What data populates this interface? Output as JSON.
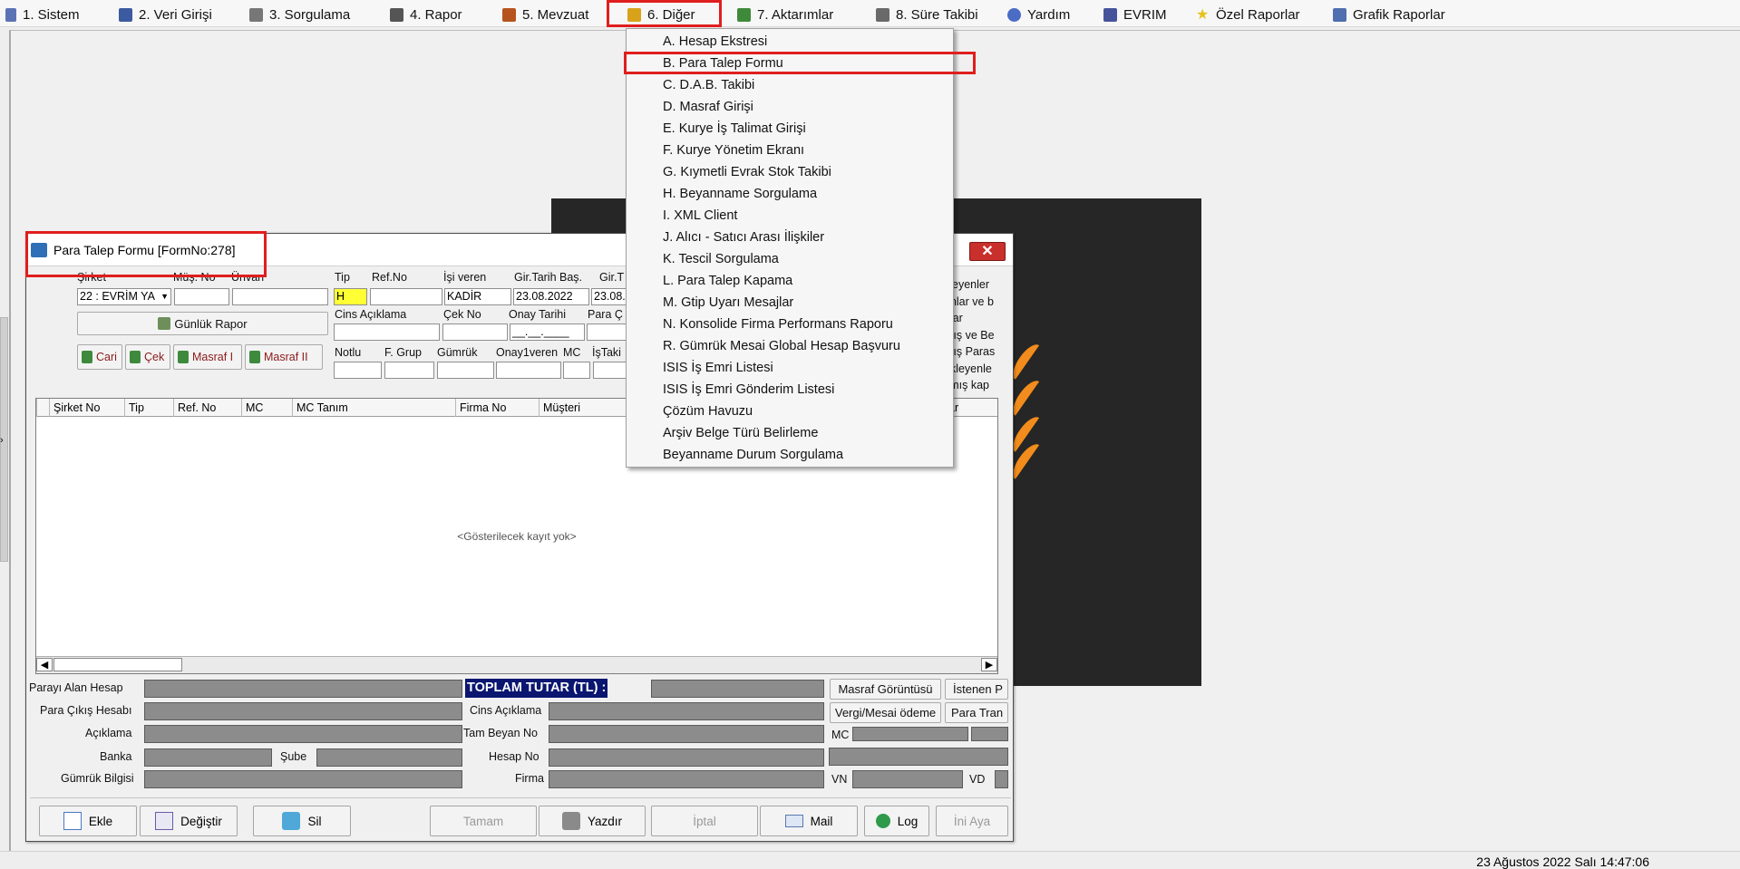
{
  "menubar": {
    "items": [
      {
        "label": "1.   Sistem",
        "icon": "system-icon",
        "color": "#5b73b5"
      },
      {
        "label": "2.   Veri Girişi",
        "icon": "data-entry-icon",
        "color": "#3c5aa0"
      },
      {
        "label": "3.   Sorgulama",
        "icon": "query-icon",
        "color": "#555555"
      },
      {
        "label": "4.   Rapor",
        "icon": "printer-icon",
        "color": "#444444"
      },
      {
        "label": "5.   Mevzuat",
        "icon": "books-icon",
        "color": "#b5541e"
      },
      {
        "label": "6.   Diğer",
        "icon": "other-icon",
        "color": "#d9a21b"
      },
      {
        "label": "7.   Aktarımlar",
        "icon": "transfer-icon",
        "color": "#3f8a3a"
      },
      {
        "label": "8. Süre Takibi",
        "icon": "calendar-icon",
        "color": "#6a6a6a"
      },
      {
        "label": "Yardım",
        "icon": "help-icon",
        "color": "#4a6cc4"
      },
      {
        "label": "EVRIM",
        "icon": "evrim-icon",
        "color": "#45549a"
      },
      {
        "label": "Özel Raporlar",
        "icon": "star-icon",
        "color": "#e6c21a"
      },
      {
        "label": "Grafik Raporlar",
        "icon": "chart-icon",
        "color": "#4f6fb0"
      }
    ]
  },
  "dropdown": {
    "items": [
      "A.   Hesap Ekstresi",
      "B.   Para Talep Formu",
      "C.   D.A.B. Takibi",
      "D.   Masraf Girişi",
      "E.   Kurye İş Talimat Girişi",
      "F.   Kurye Yönetim Ekranı",
      "G.   Kıymetli Evrak Stok Takibi",
      "H.   Beyanname Sorgulama",
      "I.    XML Client",
      "J.   Alıcı - Satıcı Arası İlişkiler",
      "K.  Tescil Sorgulama",
      "L. Para Talep Kapama",
      "M. Gtip Uyarı Mesajlar",
      "N. Konsolide Firma Performans Raporu",
      "R. Gümrük Mesai Global Hesap Başvuru",
      "ISIS İş Emri Listesi",
      "ISIS İş Emri Gönderim Listesi",
      "Çözüm Havuzu",
      "Arşiv Belge Türü Belirleme",
      "Beyanname Durum Sorgulama"
    ]
  },
  "window": {
    "title": "Para Talep Formu [FormNo:278]",
    "close": "✕"
  },
  "form": {
    "sirket_label": "Şirket",
    "sirket_value": "22 : EVRİM YA",
    "mus_no_label": "Müş. No",
    "unvan_label": "Ünvan",
    "gunluk_rapor": "Günlük Rapor",
    "btn_cari": "Cari",
    "btn_cek": "Çek",
    "btn_masraf1": "Masraf I",
    "btn_masraf2": "Masraf II",
    "tip_label": "Tip",
    "tip_value": "H",
    "refno_label": "Ref.No",
    "isiveren_label": "İşi veren",
    "isiveren_value": "KADİR",
    "girtarih_bas_label": "Gir.Tarih Baş.",
    "girtarih_bas_value": "23.08.2022",
    "girtarih_bit_label": "Gir.T",
    "girtarih_bit_value": "23.08.2",
    "cins_label": "Cins Açıklama",
    "cekno_label": "Çek No",
    "onay_tarihi_label": "Onay Tarihi",
    "onay_tarihi_value": "__.__.____",
    "para_cikis_label": "Para Ç",
    "notlu_label": "Notlu",
    "fgrup_label": "F. Grup",
    "gumruk_label": "Gümrük",
    "onay1_label": "Onay1veren",
    "mc_label": "MC",
    "istakip_label": "İşTaki",
    "right_lines": [
      "kleyenler",
      "anlar ve b",
      "ıtlar",
      "mış ve Be",
      "mış Paras",
      "ekleyenle",
      "kmış kap"
    ]
  },
  "grid": {
    "columns": [
      "Şirket No",
      "Tip",
      "Ref. No",
      "MC",
      "MC Tanım",
      "Firma No",
      "Müşteri",
      "ar"
    ],
    "empty_text": "<Gösterilecek kayıt yok>"
  },
  "footer": {
    "parayi_alan": "Parayı Alan Hesap",
    "para_cikis": "Para Çıkış Hesabı",
    "aciklama": "Açıklama",
    "banka": "Banka",
    "sube": "Şube",
    "gumruk_bilgisi": "Gümrük Bilgisi",
    "toplam": "TOPLAM TUTAR (TL) :",
    "cins_aciklama": "Cins Açıklama",
    "tam_beyan": "Tam Beyan No",
    "hesap_no": "Hesap No",
    "firma": "Firma",
    "masraf_goruntusu": "Masraf Görüntüsü",
    "istenen": "İstenen P",
    "vergi_mesai": "Vergi/Mesai ödeme",
    "para_tran": "Para Tran",
    "mc": "MC",
    "vn": "VN",
    "vd": "VD"
  },
  "toolbar": {
    "ekle": "Ekle",
    "degistir": "Değiştir",
    "sil": "Sil",
    "tamam": "Tamam",
    "yazdir": "Yazdır",
    "iptal": "İptal",
    "mail": "Mail",
    "log": "Log",
    "ini_ayar": "İni Aya"
  },
  "status": {
    "clock": "23 Ağustos 2022 Salı 14:47:06"
  },
  "colors": {
    "highlight_red": "#e01e1e",
    "total_bg": "#0a1670",
    "tip_yellow": "#ffff33",
    "logo_orange": "#f28c1c"
  }
}
